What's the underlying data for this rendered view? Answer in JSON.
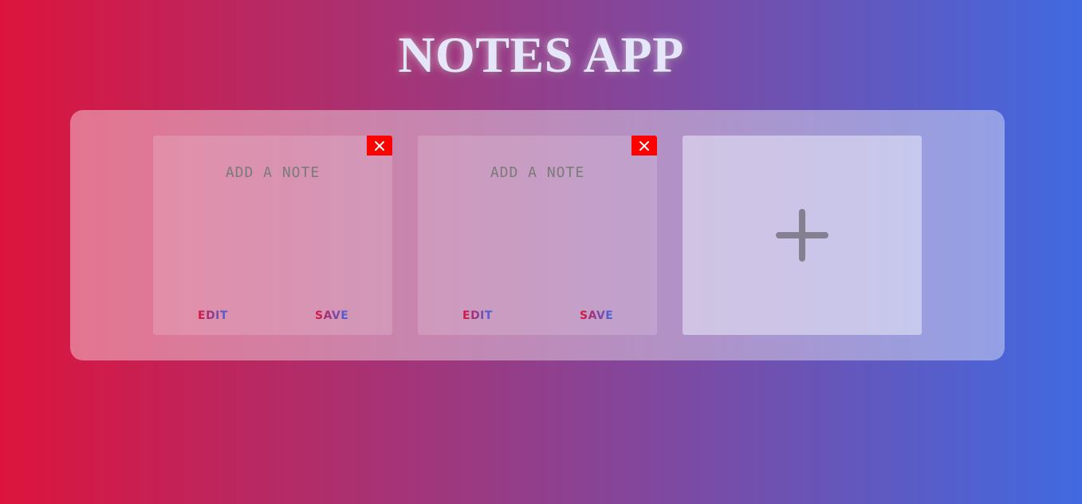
{
  "app": {
    "title": "NOTES APP"
  },
  "notes": [
    {
      "placeholder": "ADD A NOTE",
      "edit_label": "EDIT",
      "save_label": "SAVE"
    },
    {
      "placeholder": "ADD A NOTE",
      "edit_label": "EDIT",
      "save_label": "SAVE"
    }
  ],
  "add_card": {
    "icon": "plus-icon"
  },
  "colors": {
    "gradient_start": "#dc143c",
    "gradient_end": "#4169e1",
    "delete_button": "#ff0000",
    "title_text": "#e6e6fa"
  }
}
